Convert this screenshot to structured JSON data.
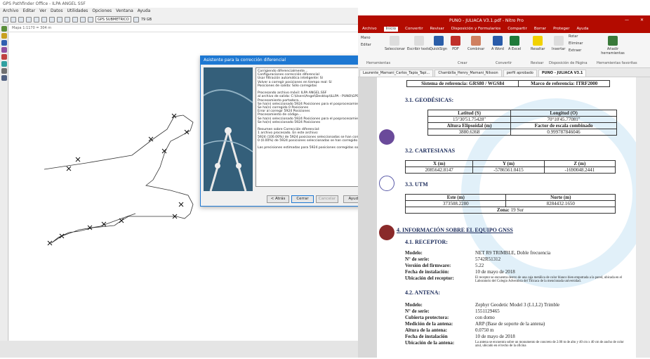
{
  "gps": {
    "title": "GPS Pathfinder Office - ILPA ANGEL SSF",
    "menu": [
      "Archivo",
      "Editar",
      "Ver",
      "Datos",
      "Utilidades",
      "Opciones",
      "Ventana",
      "Ayuda"
    ],
    "combo": "GPS SUBMETRICO",
    "disk": "79 GB",
    "map_title": "Mapa 1:1170 = 304 m"
  },
  "dialog": {
    "title": "Asistente para la corrección diferencial",
    "log": [
      "Corrigiendo diferencialmente...",
      "Configuraciones corrección diferencial",
      "  Usar filtración automática inteligente: Sí",
      "Volver a corregir posiciones en tiempo real: Sí",
      "  Posiciones de salida: Sólo corregidas",
      "",
      "Procesando archivo móvil: ILPA ANGEL.SSF",
      "  al archivo de salida: C:\\Users\\Angel\\Desktop\\ILLPA - PUNO\\GPS SUBME",
      "  Procesamiento portadora...",
      "    Se ha(n) seleccionado 5924 Posiciones para el posprocesamiento",
      "    Se ha(n) corregido 0 Posiciones",
      "    Error al corregir 5924 Posiciones",
      "  Procesamiento de código...",
      "    Se ha(n) seleccionado 5924 Posiciones para el posprocesamiento",
      "    Se ha(n) seleccionado 5924 Posiciones",
      "",
      "Resumen sobre Corrección diferencial:",
      "  1 archivo procesado. En este archivo:",
      "    5924 (100.00%) de 5924 posiciones seleccionadas se han corregido por",
      "    0 (0.00%) de 5924 posiciones seleccionadas se han corregido por portad",
      "",
      "  Las precisiones estimadas para 5924 posiciones corregidas son las siguiente"
    ],
    "back": "< Atrás",
    "close": "Cerrar",
    "cancel": "Cancelar",
    "help": "Ayuda"
  },
  "pdf": {
    "title": "PUNO - JULIACA V3.1.pdf - Nitro Pro",
    "menu": [
      "Archivo",
      "Inicio",
      "Convertir",
      "Revisar",
      "Disposición y Formularios",
      "Compartir",
      "Borrar",
      "Proteger",
      "Ayuda"
    ],
    "ribbon": [
      "Mano",
      "Editar",
      "Seleccionar",
      "Escribir texto",
      "QuickSign",
      "PDF",
      "Combinar",
      "A Word",
      "A Excel",
      "Resaltar",
      "Insertar",
      "Rotar",
      "Eliminar",
      "Extraer",
      "Añadir herramientas"
    ],
    "groups": [
      "Herramientas",
      "Crear",
      "Convertir",
      "Revisar",
      "Disposición de Página",
      "Herramientas favoritas"
    ],
    "tabs": [
      "Laurente_Mamani_Carlos_Tapia_Tapi...",
      "Chambilla_Henry_Mamani_Nilsson",
      "perfil aprobado",
      "PUNO - JULIACA V3.1"
    ]
  },
  "doc": {
    "ref": {
      "sys_label": "Sistema de referencia:",
      "sys": "GRS80 / WGS84",
      "frame_label": "Marco de referencia:",
      "frame": "ITRF2000"
    },
    "geo_head": "3.1. GEODÉSICAS:",
    "geo": {
      "lat_h": "Latitud (S)",
      "lon_h": "Longitud (O)",
      "lat": "15°30'51.75428\"",
      "lon": "70°10'45.77081\"",
      "alt_h": "Altura Elipsoidal (m)",
      "fe_h": "Factor de escala combinado",
      "alt": "3880.6368",
      "fe": "0.999787846046"
    },
    "cart_head": "3.2. CARTESIANAS",
    "cart": {
      "x_h": "X (m)",
      "y_h": "Y (m)",
      "z_h": "Z (m)",
      "x": "2085642.8147",
      "y": "-5786561.0415",
      "z": "-1690048.2441"
    },
    "utm_head": "3.3. UTM",
    "utm": {
      "e_h": "Este (m)",
      "n_h": "Norte (m)",
      "e": "373508.2280",
      "n": "8284432.1650",
      "zone_label": "Zona:",
      "zone": "19 Sur"
    },
    "eq_head": "4. INFORMACIÓN SOBRE EL EQUIPO GNSS",
    "rec_head": "4.1. RECEPTOR:",
    "rec": [
      {
        "l": "Modelo:",
        "v": "NET R9 TRIMBLE, Doble frecuencia"
      },
      {
        "l": "N° de serie:",
        "v": "5742R51312"
      },
      {
        "l": "Versión del firmware:",
        "v": "5.22"
      },
      {
        "l": "Fecha de instalación:",
        "v": "10 de mayo de 2018"
      },
      {
        "l": "Ubicación del receptor:",
        "v": "El receptor se encuentra dentro de una caja metálica de color blanco bien empotrada a la pared, ubicada en el Laboratorio del Colegio Adventista del Titicaca de la mencionada universidad."
      }
    ],
    "ant_head": "4.2. ANTENA:",
    "ant": [
      {
        "l": "Modelo:",
        "v": "Zephyr Geodetic Model 3 (L1,L2) Trimble"
      },
      {
        "l": "N° de serie:",
        "v": "1551129465"
      },
      {
        "l": "Cubierta protectora:",
        "v": "con domo"
      },
      {
        "l": "Medición de la antena:",
        "v": "ARP (Base de soporte de la antena)"
      },
      {
        "l": "Altura de la antena:",
        "v": "0.0750 m"
      },
      {
        "l": "Fecha de instalación",
        "v": "10 de mayo de 2018"
      },
      {
        "l": "Ubicación de la antena:",
        "v": "La antena se encuentra sobre un monumento de concreto de 2.00 m de alto y 40 cm x 40 cm de ancho de color azul, ubicado en el techo de la oficina"
      }
    ]
  }
}
